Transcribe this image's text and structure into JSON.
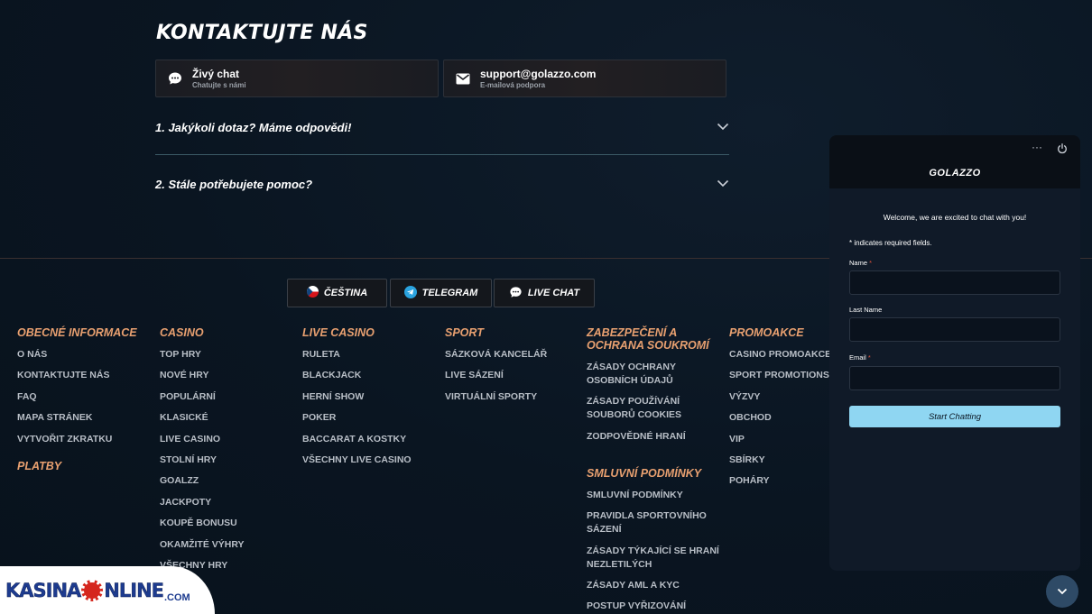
{
  "contact": {
    "title": "KONTAKTUJTE NÁS",
    "live_chat": {
      "title": "Živý chat",
      "subtitle": "Chatujte s námi"
    },
    "email": {
      "title": "support@golazzo.com",
      "subtitle": "E-mailová podpora"
    }
  },
  "faq": [
    {
      "question": "1. Jakýkoli dotaz? Máme odpovědi!"
    },
    {
      "question": "2. Stále potřebujete pomoc?"
    }
  ],
  "footer_buttons": {
    "language": "ČEŠTINA",
    "telegram": "TELEGRAM",
    "live_chat": "LIVE CHAT"
  },
  "footer": {
    "general": {
      "heading": "OBECNÉ INFORMACE",
      "items": [
        "O NÁS",
        "KONTAKTUJTE NÁS",
        "FAQ",
        "MAPA STRÁNEK",
        "VYTVOŘIT ZKRATKU"
      ]
    },
    "payments": {
      "heading": "PLATBY"
    },
    "casino": {
      "heading": "CASINO",
      "items": [
        "TOP HRY",
        "NOVÉ HRY",
        "POPULÁRNÍ",
        "KLASICKÉ",
        "LIVE CASINO",
        "STOLNÍ HRY",
        "GOALZZ",
        "JACKPOTY",
        "KOUPĚ BONUSU",
        "OKAMŽITÉ VÝHRY",
        "VŠECHNY HRY"
      ]
    },
    "live_casino": {
      "heading": "LIVE CASINO",
      "items": [
        "RULETA",
        "BLACKJACK",
        "HERNÍ SHOW",
        "POKER",
        "BACCARAT A KOSTKY",
        "VŠECHNY LIVE CASINO"
      ]
    },
    "sport": {
      "heading": "SPORT",
      "items": [
        "SÁZKOVÁ KANCELÁŘ",
        "LIVE SÁZENÍ",
        "VIRTUÁLNÍ SPORTY"
      ]
    },
    "security": {
      "heading": "ZABEZPEČENÍ A OCHRANA SOUKROMÍ",
      "items": [
        "ZÁSADY OCHRANY OSOBNÍCH ÚDAJŮ",
        "ZÁSADY POUŽÍVÁNÍ SOUBORŮ COOKIES",
        "ZODPOVĚDNÉ HRANÍ"
      ]
    },
    "terms": {
      "heading": "SMLUVNÍ PODMÍNKY",
      "items": [
        "SMLUVNÍ PODMÍNKY",
        "PRAVIDLA SPORTOVNÍHO SÁZENÍ",
        "ZÁSADY TÝKAJÍCÍ SE HRANÍ NEZLETILÝCH",
        "ZÁSADY AML A KYC",
        "POSTUP VYŘIZOVÁNÍ"
      ]
    },
    "promo": {
      "heading": "PROMOAKCE",
      "items": [
        "CASINO PROMOAKCE",
        "SPORT PROMOTIONS",
        "VÝZVY",
        "OBCHOD",
        "VIP",
        "SBÍRKY",
        "POHÁRY"
      ]
    }
  },
  "chat_widget": {
    "menu": "···",
    "logo": "GOLAZZO",
    "welcome": "Welcome, we are excited to chat with you!",
    "required_note": "* indicates required fields.",
    "name_label": "Name",
    "last_name_label": "Last Name",
    "email_label": "Email",
    "required_mark": "*",
    "name_value": "",
    "last_name_value": "",
    "email_value": "",
    "button": "Start Chatting"
  },
  "watermark": {
    "left": "KASINA",
    "right": "NLINE",
    "suffix": ".COM"
  },
  "colors": {
    "accent_orange": "#e8a070",
    "button_blue": "#8fd6f2",
    "required_red": "#e0533c"
  }
}
